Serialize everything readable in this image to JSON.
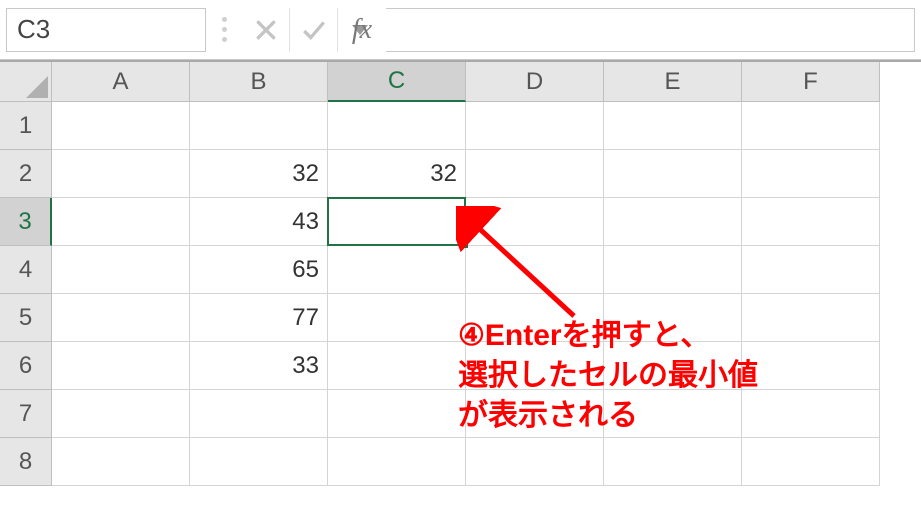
{
  "formula_bar": {
    "name_box_value": "C3",
    "cancel_title": "キャンセル",
    "enter_title": "確定",
    "fx_label": "fx",
    "formula_value": ""
  },
  "columns": [
    "A",
    "B",
    "C",
    "D",
    "E",
    "F"
  ],
  "rows": [
    "1",
    "2",
    "3",
    "4",
    "5",
    "6",
    "7",
    "8"
  ],
  "active_col": "C",
  "active_row": "3",
  "cells": {
    "B2": "32",
    "B3": "43",
    "B4": "65",
    "B5": "77",
    "B6": "33",
    "C2": "32"
  },
  "annotation": {
    "text": "④Enterを押すと、\n選択したセルの最小値\nが表示される"
  }
}
